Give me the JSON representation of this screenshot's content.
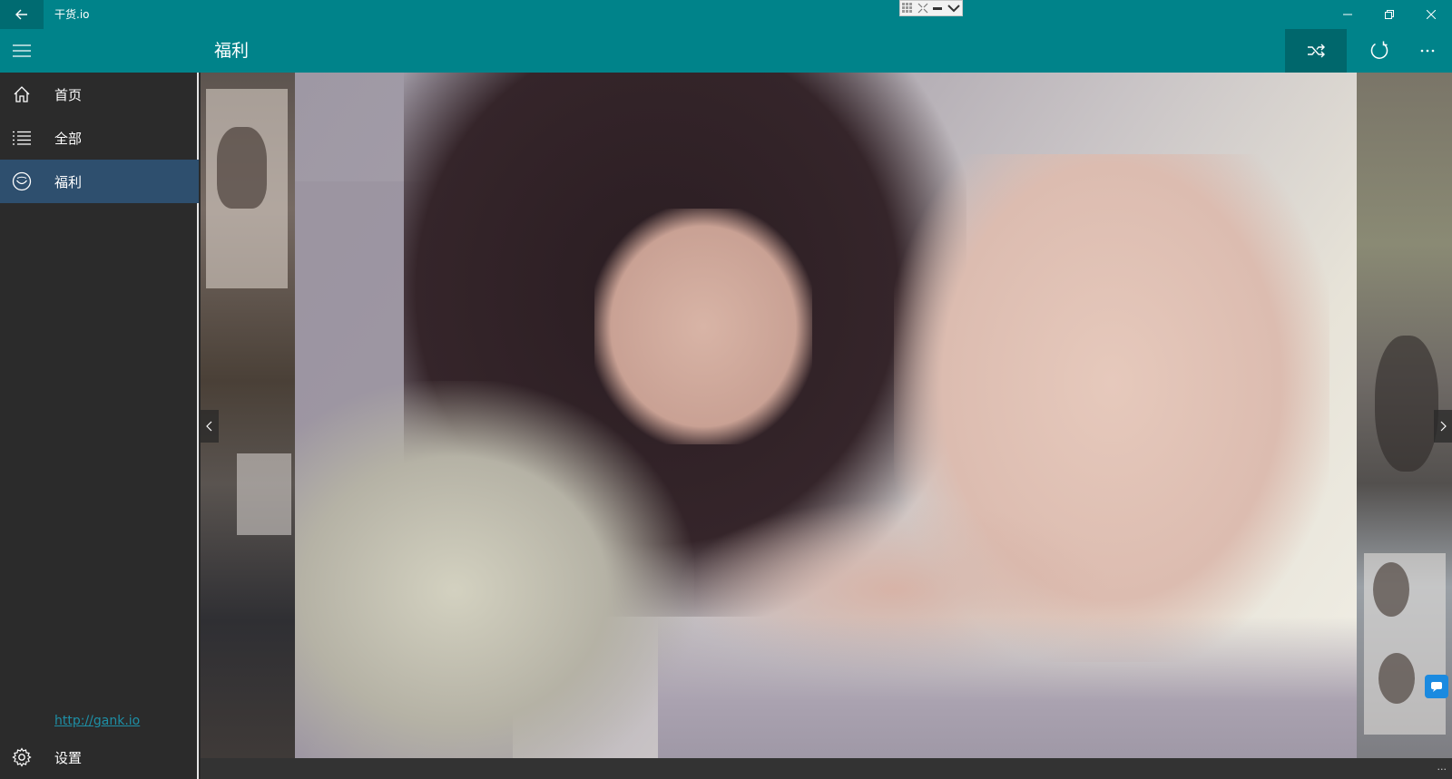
{
  "window": {
    "title": "干货.io"
  },
  "appbar": {
    "page_title": "福利",
    "actions": [
      {
        "name": "shuffle",
        "icon": "shuffle-icon",
        "active": true
      },
      {
        "name": "refresh",
        "icon": "refresh-icon",
        "active": false
      },
      {
        "name": "more",
        "icon": "more-icon",
        "active": false
      }
    ]
  },
  "sidebar": {
    "items": [
      {
        "label": "首页",
        "icon": "home-icon",
        "selected": false
      },
      {
        "label": "全部",
        "icon": "list-icon",
        "selected": false
      },
      {
        "label": "福利",
        "icon": "smiley-icon",
        "selected": true
      }
    ],
    "link": "http://gank.io",
    "settings_label": "设置"
  },
  "colors": {
    "accent": "#00838a",
    "selected_nav": "#2e4f6e",
    "sidebar_bg": "#2b2b2b",
    "link": "#1e8fa6"
  }
}
